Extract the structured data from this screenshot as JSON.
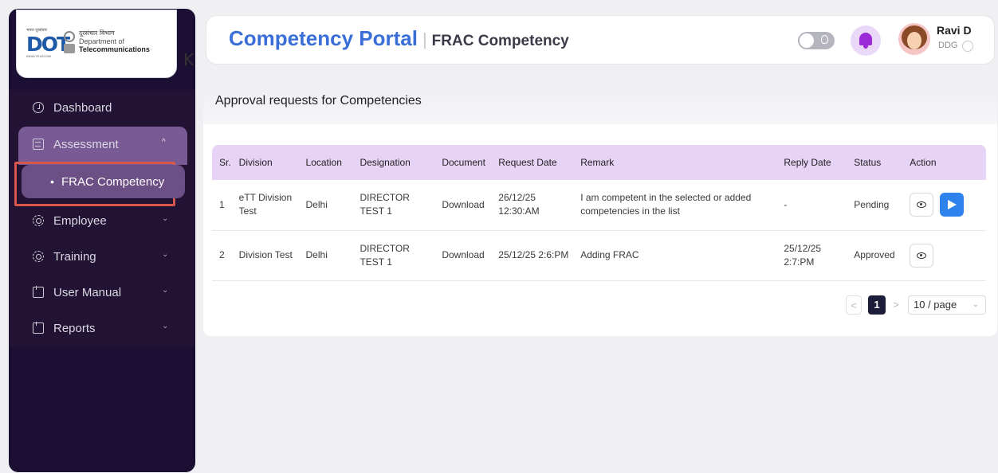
{
  "logo": {
    "hindi_top": "भारत दूरसंचार",
    "mark": "DOT",
    "mark_sub": "INDIA TELECOM",
    "dept_hindi": "दूरसंचार विभाग",
    "dept_line1": "Department of",
    "dept_line2": "Telecommunications",
    "collapse": "K"
  },
  "sidebar": {
    "items": [
      {
        "label": "Dashboard",
        "icon": "dashboard-icon"
      },
      {
        "label": "Assessment",
        "icon": "assessment-icon",
        "chevron": "^"
      },
      {
        "label": "FRAC Competency"
      },
      {
        "label": "Employee",
        "icon": "gear-icon",
        "chevron": "⌄"
      },
      {
        "label": "Training",
        "icon": "gear-icon",
        "chevron": "⌄"
      },
      {
        "label": "User Manual",
        "icon": "book-icon",
        "chevron": "⌄"
      },
      {
        "label": "Reports",
        "icon": "book-icon",
        "chevron": "⌄"
      }
    ]
  },
  "header": {
    "title": "Competency Portal",
    "separator": "|",
    "subtitle": "FRAC Competency",
    "user_name": "Ravi D",
    "user_role": "DDG"
  },
  "main": {
    "title": "Approval requests for Competencies",
    "columns": [
      "Sr.",
      "Division",
      "Location",
      "Designation",
      "Document",
      "Request Date",
      "Remark",
      "Reply Date",
      "Status",
      "Action"
    ],
    "rows": [
      {
        "sr": "1",
        "division": "eTT Division Test",
        "location": "Delhi",
        "designation": "DIRECTOR TEST 1",
        "document": "Download",
        "request_date": "26/12/25 12:30:AM",
        "remark": "I am competent in the selected or added competencies in the list",
        "reply_date": "-",
        "status": "Pending"
      },
      {
        "sr": "2",
        "division": "Division Test",
        "location": "Delhi",
        "designation": "DIRECTOR TEST 1",
        "document": "Download",
        "request_date": "25/12/25 2:6:PM",
        "remark": "Adding FRAC",
        "reply_date": "25/12/25 2:7:PM",
        "status": "Approved"
      }
    ]
  },
  "pagination": {
    "prev": "<",
    "page": "1",
    "next": ">",
    "page_size": "10 / page",
    "page_size_arrow": "⌄"
  },
  "colors": {
    "sidebar_bg": "#1b0f33",
    "accent_purple": "#7a5a94",
    "brand_blue": "#3a6fd8",
    "table_header": "#e7d3f6",
    "send_button": "#2e82ec",
    "highlight_border": "#d7574a"
  }
}
